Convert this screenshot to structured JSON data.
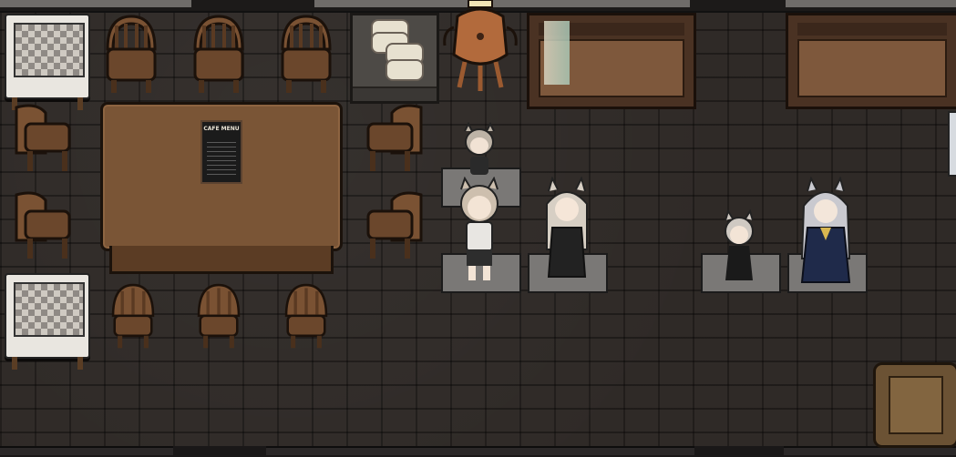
{
  "scene": {
    "menu_board_text": "CAFE MENU",
    "colors": {
      "floor": "#2f2a27",
      "wood_table": "#7a5536",
      "chair_wood": "#7a5233",
      "pad": "#7a7876",
      "bed_frame": "#4a3223"
    },
    "pawns": [
      {
        "name": "pawn-1",
        "hair": "#bdb3a6",
        "outfit": "#2a2a2a"
      },
      {
        "name": "pawn-2",
        "hair": "#cdbfae",
        "outfit": "#e8e6e2"
      },
      {
        "name": "pawn-3",
        "hair": "#d7cfc4",
        "outfit": "#222222"
      },
      {
        "name": "pawn-4",
        "hair": "#cfc9c2",
        "outfit": "#1a1a1a"
      },
      {
        "name": "pawn-5",
        "hair": "#c9c9cf",
        "outfit": "#1f2a4a"
      }
    ]
  }
}
